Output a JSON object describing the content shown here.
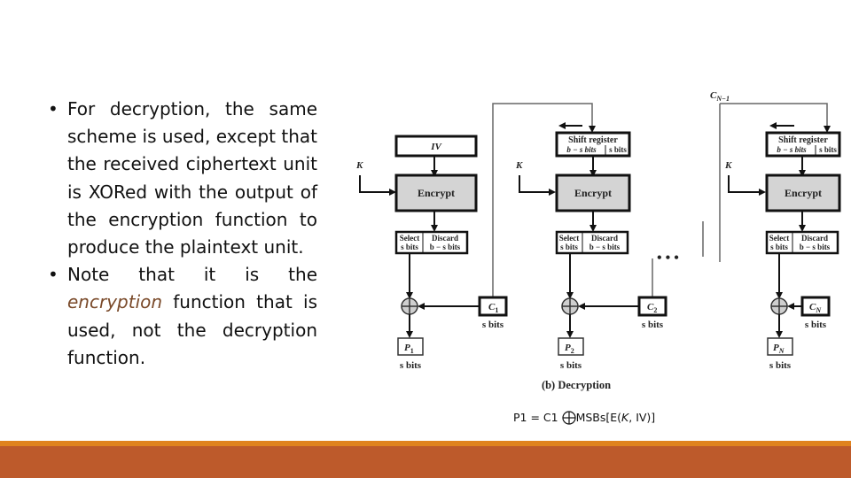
{
  "slide": {
    "bullets": [
      {
        "parts": [
          {
            "text": "For decryption, the same scheme is used, except that the received ciphertext unit is XORed with the output of the encryption function to produce the plaintext unit.",
            "emphasis": false
          }
        ]
      },
      {
        "parts": [
          {
            "text": "Note that it is the ",
            "emphasis": false
          },
          {
            "text": "encryption",
            "emphasis": true
          },
          {
            "text": " function that is used, not the decryption function.",
            "emphasis": false
          }
        ]
      }
    ],
    "bullet_glyph": "•",
    "colors": {
      "emphasis": "#7a4a2a",
      "accent_bar": "#e0831e",
      "footer_bar": "#bd5a2b",
      "encrypt_fill": "#d4d4d4"
    }
  },
  "diagram": {
    "caption": "(b) Decryption",
    "feedback_label": "C",
    "feedback_sub": "N−1",
    "stages": [
      {
        "input_box": "IV",
        "input_italic": true,
        "key": "K",
        "encrypt": "Encrypt",
        "select": [
          "Select",
          "s bits"
        ],
        "discard": [
          "Discard",
          "b − s bits"
        ],
        "cipher": "C",
        "cipher_sub": "1",
        "cipher_bits": "s bits",
        "plain": "P",
        "plain_sub": "1",
        "plain_bits": "s bits"
      },
      {
        "input_box": "Shift register",
        "shift_left": "b − s bits",
        "shift_right": "s bits",
        "key": "K",
        "encrypt": "Encrypt",
        "select": [
          "Select",
          "s bits"
        ],
        "discard": [
          "Discard",
          "b − s bits"
        ],
        "cipher": "C",
        "cipher_sub": "2",
        "cipher_bits": "s bits",
        "plain": "P",
        "plain_sub": "2",
        "plain_bits": "s bits"
      },
      {
        "input_box": "Shift register",
        "shift_left": "b − s bits",
        "shift_right": "s bits",
        "key": "K",
        "encrypt": "Encrypt",
        "select": [
          "Select",
          "s bits"
        ],
        "discard": [
          "Discard",
          "b − s bits"
        ],
        "cipher": "C",
        "cipher_sub": "N",
        "cipher_bits": "s bits",
        "plain": "P",
        "plain_sub": "N",
        "plain_bits": "s bits"
      }
    ],
    "ellipsis": "• • •"
  },
  "formula": {
    "lhs": "P1 = C1",
    "rhs_prefix": "MSBs[E(",
    "rhs_k": "K",
    "rhs_suffix": ", IV)]"
  }
}
